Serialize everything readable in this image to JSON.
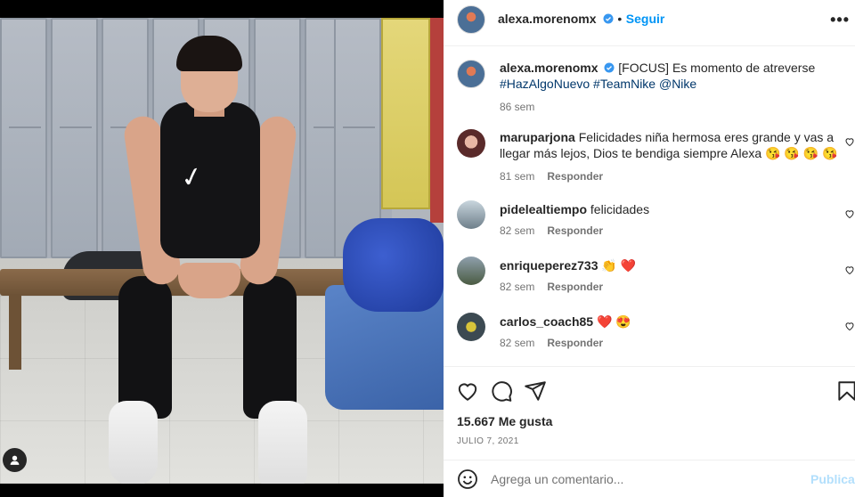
{
  "post": {
    "username": "alexa.morenomx",
    "follow_label": "Seguir",
    "more_icon": "more-horizontal-icon",
    "caption": {
      "text": "[FOCUS] Es momento de atreverse",
      "hashtags": "#HazAlgoNuevo #TeamNike @Nike",
      "time": "86 sem"
    },
    "likes": "15.667 Me gusta",
    "date": "JULIO 7, 2021"
  },
  "comments": [
    {
      "user": "maruparjona",
      "text": "Felicidades niña hermosa eres grande y vas a llegar más lejos, Dios te bendiga siempre Alexa 😘 😘 😘 😘",
      "time": "81 sem",
      "reply": "Responder"
    },
    {
      "user": "pidelealtiempo",
      "text": "felicidades",
      "time": "82 sem",
      "reply": "Responder"
    },
    {
      "user": "enriqueperez733",
      "text": "👏 ❤️",
      "time": "82 sem",
      "reply": "Responder"
    },
    {
      "user": "carlos_coach85",
      "text": "❤️ 😍",
      "time": "82 sem",
      "reply": "Responder"
    }
  ],
  "add_comment": {
    "placeholder": "Agrega un comentario...",
    "post_label": "Publicar"
  },
  "colors": {
    "link": "#00376b",
    "follow": "#0095f6",
    "muted": "#737373"
  }
}
